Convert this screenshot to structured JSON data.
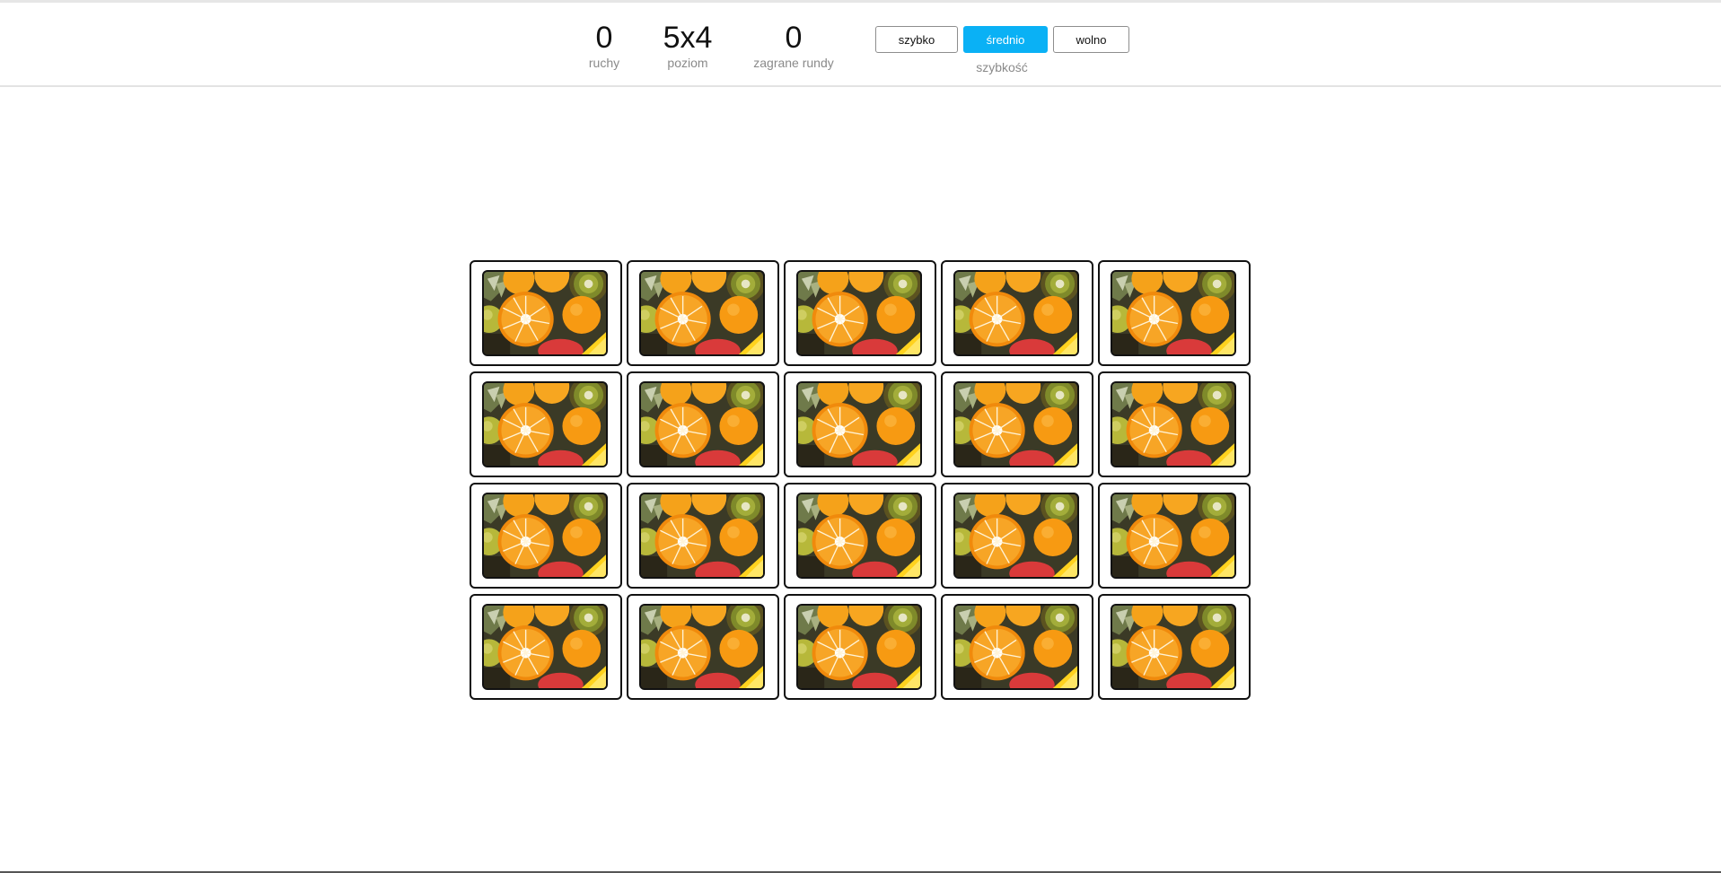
{
  "header": {
    "stats": [
      {
        "value": "0",
        "label": "ruchy"
      },
      {
        "value": "5x4",
        "label": "poziom"
      },
      {
        "value": "0",
        "label": "zagrane rundy"
      }
    ],
    "speed": {
      "label": "szybkość",
      "options": [
        "szybko",
        "średnio",
        "wolno"
      ],
      "selected": "średnio",
      "active_color": "#0ab1f5"
    }
  },
  "board": {
    "columns": 5,
    "rows": 4,
    "card_back_image": "fruit-citrus-kiwi-image",
    "cards_face_down": 20
  }
}
